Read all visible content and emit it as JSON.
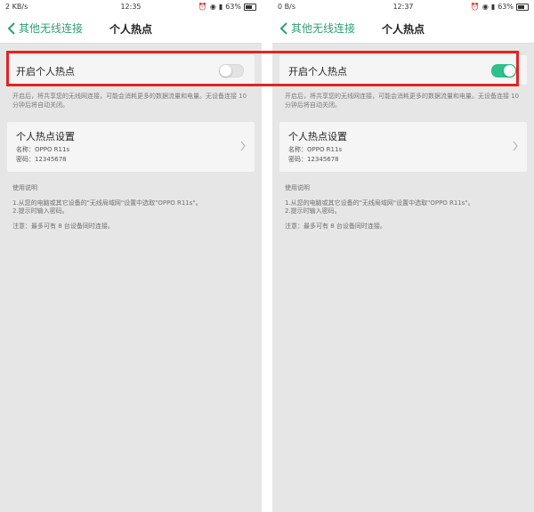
{
  "left": {
    "status": {
      "carrier": "2 KB/s",
      "time": "12:35",
      "battery": "63%"
    },
    "nav": {
      "back_label": "其他无线连接",
      "title": "个人热点"
    },
    "hotspot_toggle": {
      "label": "开启个人热点",
      "state": "off"
    },
    "description": "开启后，将共享您的无线网连接，可能会消耗更多的数据流量和电量。无设备连接 10 分钟后将自动关闭。",
    "settings": {
      "title": "个人热点设置",
      "name_line": "名称：OPPO R11s",
      "password_line": "密码：12345678"
    },
    "usage": {
      "heading": "使用说明",
      "step1": "1.从您的电脑或其它设备的\"无线局域网\"设置中选取\"OPPO R11s\"。",
      "step2": "2.提示时输入密码。",
      "note": "注意：最多可有 8 台设备同时连接。"
    }
  },
  "right": {
    "status": {
      "carrier": "0 B/s",
      "time": "12:37",
      "battery": "63%"
    },
    "nav": {
      "back_label": "其他无线连接",
      "title": "个人热点"
    },
    "hotspot_toggle": {
      "label": "开启个人热点",
      "state": "on"
    },
    "description": "开启后，将共享您的无线网连接，可能会消耗更多的数据流量和电量。无设备连接 10 分钟后将自动关闭。",
    "settings": {
      "title": "个人热点设置",
      "name_line": "名称：OPPO R11s",
      "password_line": "密码：12345678"
    },
    "usage": {
      "heading": "使用说明",
      "step1": "1.从您的电脑或其它设备的\"无线局域网\"设置中选取\"OPPO R11s\"。",
      "step2": "2.提示时输入密码。",
      "note": "注意：最多可有 8 台设备同时连接。"
    }
  },
  "colors": {
    "accent": "#2e9e74",
    "toggle_on": "#2ec28a",
    "highlight": "#e52222",
    "background": "#e6e6e6"
  },
  "icons": [
    "signal-icon",
    "wifi-icon",
    "alarm-icon",
    "battery-icon",
    "chevron-left-icon",
    "chevron-right-icon"
  ]
}
